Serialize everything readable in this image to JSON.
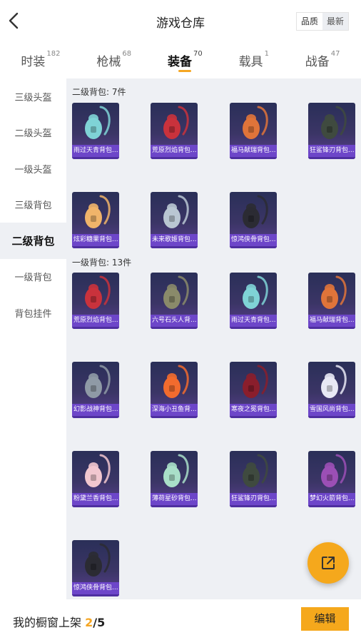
{
  "header": {
    "title": "游戏仓库",
    "sort_options": [
      "品质",
      "最新"
    ]
  },
  "tabs": [
    {
      "label": "时装",
      "count": "182"
    },
    {
      "label": "枪械",
      "count": "68"
    },
    {
      "label": "装备",
      "count": "70",
      "active": true
    },
    {
      "label": "载具",
      "count": "1"
    },
    {
      "label": "战备",
      "count": "47"
    }
  ],
  "sidebar": {
    "items": [
      "三级头盔",
      "二级头盔",
      "一级头盔",
      "三级背包",
      "二级背包",
      "一级背包",
      "背包挂件"
    ],
    "active_index": 4
  },
  "sections": [
    {
      "title": "二级背包: 7件",
      "items": [
        {
          "name": "雨过天青背包...",
          "color": "#7fd3d6"
        },
        {
          "name": "荒原烈焰背包...",
          "color": "#c9323c"
        },
        {
          "name": "福马献瑞背包...",
          "color": "#e0743a"
        },
        {
          "name": "狂鲨锋刃背包...",
          "color": "#3f4a3f"
        },
        {
          "name": "炫彩糖果背包...",
          "color": "#f0b46a"
        },
        {
          "name": "未来歌姬背包...",
          "color": "#b9c6d2"
        },
        {
          "name": "惊鸿侠骨背包...",
          "color": "#2b2b33"
        }
      ]
    },
    {
      "title": "一级背包: 13件",
      "items": [
        {
          "name": "荒原烈焰背包...",
          "color": "#c9323c"
        },
        {
          "name": "六号石头人背...",
          "color": "#8a8a6a"
        },
        {
          "name": "雨过天青背包...",
          "color": "#7fd3d6"
        },
        {
          "name": "福马献瑞背包...",
          "color": "#e0743a"
        },
        {
          "name": "幻影战神背包...",
          "color": "#8f9aa6"
        },
        {
          "name": "深海小丑鱼背...",
          "color": "#f26b2e"
        },
        {
          "name": "寒夜之冕背包...",
          "color": "#8a1e2c"
        },
        {
          "name": "雪国风尚背包...",
          "color": "#e8e8f4"
        },
        {
          "name": "粉黛兰香背包...",
          "color": "#f2c7cf"
        },
        {
          "name": "薄荷星砂背包...",
          "color": "#a9dfc8"
        },
        {
          "name": "狂鲨锋刃背包...",
          "color": "#3f4a3f"
        },
        {
          "name": "梦幻火箭背包...",
          "color": "#9b4fb5"
        },
        {
          "name": "惊鸿侠骨背包...",
          "color": "#2b2b33"
        }
      ]
    }
  ],
  "bottom": {
    "label": "我的橱窗上架 ",
    "current": "2",
    "separator": "/",
    "total": "5",
    "edit_label": "编辑"
  },
  "fab": {
    "icon": "share-external-icon"
  },
  "colors": {
    "accent": "#f5a81c",
    "content_bg": "#eef0f4",
    "item_label_bg": "#6d46c9"
  }
}
